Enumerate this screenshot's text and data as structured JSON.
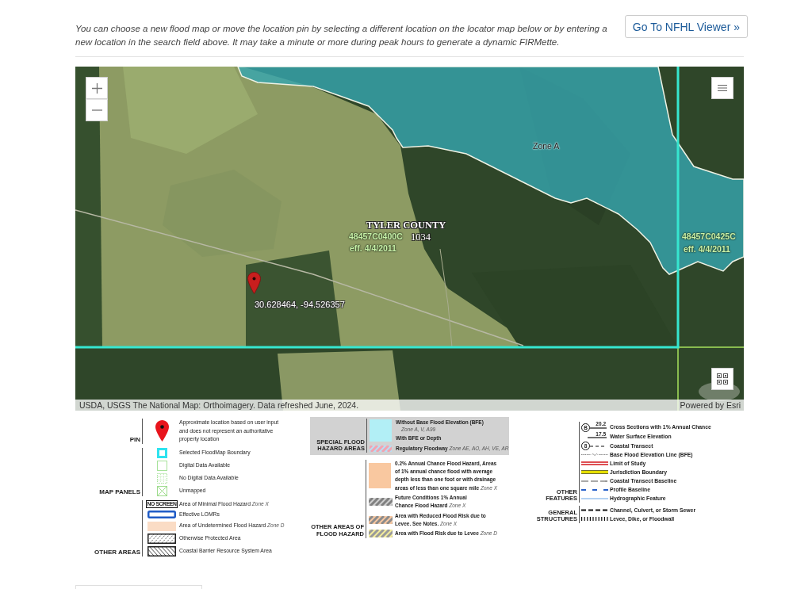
{
  "intro": {
    "text": "You can choose a new flood map or move the location pin by selecting a different location on the locator map below or by entering a new location in the search field above. It may take a minute or more during peak hours to generate a dynamic FIRMette.",
    "button": "Go To NFHL Viewer »"
  },
  "map": {
    "labels": [
      {
        "kind": "zone",
        "text": "Zone A"
      },
      {
        "kind": "county",
        "text": "TYLER COUNTY"
      },
      {
        "kind": "panel",
        "text": "48457C0400C"
      },
      {
        "kind": "community",
        "text": "1034"
      },
      {
        "kind": "date",
        "text": "eff. 4/4/2011"
      },
      {
        "kind": "panel",
        "text": "48457C0425C"
      },
      {
        "kind": "date",
        "text": "eff. 4/4/2011"
      }
    ],
    "pin": {
      "coordinates": "30.628464, -94.526357"
    },
    "attribution": "USDA, USGS The National Map: Orthoimagery. Data refreshed June, 2024.",
    "powered_by": "Powered by Esri"
  },
  "legend": {
    "columns": [
      {
        "groups": [
          {
            "title": "PIN",
            "shaded": false,
            "items": [
              {
                "kind": "pin",
                "text": "Approximate location based on user input and does not represent an authoritative property location"
              }
            ]
          },
          {
            "title": "MAP PANELS",
            "shaded": false,
            "items": [
              {
                "kind": "selected-boundary",
                "text": "Selected FloodMap Boundary"
              },
              {
                "kind": "digital",
                "text": "Digital Data Available"
              },
              {
                "kind": "no-digital",
                "text": "No Digital Data Available"
              },
              {
                "kind": "unmapped",
                "text": "Unmapped"
              }
            ]
          },
          {
            "title": "OTHER AREAS",
            "shaded": false,
            "items": [
              {
                "kind": "no-screen",
                "symbol_text": "NO SCREEN",
                "text": "Area of Minimal Flood Hazard",
                "zone": "Zone X"
              },
              {
                "kind": "lomr",
                "text": "Effective LOMRs"
              },
              {
                "kind": "undetermined",
                "text": "Area of Undetermined Flood Hazard",
                "zone": "Zone D"
              },
              {
                "kind": "protected",
                "text": "Otherwise Protected Area"
              },
              {
                "kind": "cbrs",
                "text": "Coastal Barrier Resource System Area"
              }
            ]
          }
        ]
      },
      {
        "groups": [
          {
            "title": "SPECIAL FLOOD HAZARD AREAS",
            "shaded": true,
            "items": [
              {
                "kind": "no-bfe",
                "text": "Without Base Flood Elevation (BFE)",
                "zone": "Zone A, V, A99"
              },
              {
                "kind": "with-bfe",
                "text": "With BFE or Depth"
              },
              {
                "kind": "floodway",
                "text": "Regulatory Floodway",
                "zone": "Zone AE, AO, AH, VE, AR"
              }
            ]
          },
          {
            "title": "OTHER AREAS OF FLOOD HAZARD",
            "shaded": false,
            "items": [
              {
                "kind": "x-shaded",
                "text": "0.2% Annual Chance Flood Hazard, Areas of 1% annual chance flood with average depth less than one foot or with drainage areas of less than one square mile",
                "zone": "Zone X"
              },
              {
                "kind": "future",
                "text": "Future Conditions 1% Annual Chance Flood Hazard",
                "zone": "Zone X"
              },
              {
                "kind": "reduced-levee",
                "text": "Area with Reduced Flood Risk due to Levee. See Notes.",
                "zone": "Zone X"
              },
              {
                "kind": "levee-risk",
                "text": "Area with Flood Risk due to Levee",
                "zone": "Zone D"
              }
            ]
          }
        ]
      },
      {
        "groups": [
          {
            "title": "OTHER FEATURES",
            "shaded": false,
            "items": [
              {
                "kind": "cross-section",
                "marker": "B",
                "value": "20.2",
                "text": "Cross Sections with 1% Annual Chance"
              },
              {
                "kind": "wse",
                "value": "17.5",
                "text": "Water Surface Elevation"
              },
              {
                "kind": "coastal-transect",
                "marker": "8",
                "text": "Coastal Transect"
              },
              {
                "kind": "bfe-line",
                "text": "Base Flood Elevation Line (BFE)"
              },
              {
                "kind": "limit-study",
                "text": "Limit of Study"
              },
              {
                "kind": "jurisdiction",
                "text": "Jurisdiction Boundary"
              },
              {
                "kind": "ct-baseline",
                "text": "Coastal Transect Baseline"
              },
              {
                "kind": "profile-baseline",
                "text": "Profile Baseline"
              },
              {
                "kind": "hydro",
                "text": "Hydrographic Feature"
              }
            ]
          },
          {
            "title": "GENERAL STRUCTURES",
            "shaded": false,
            "items": [
              {
                "kind": "channel",
                "text": "Channel, Culvert, or Storm Sewer"
              },
              {
                "kind": "levee",
                "text": "Levee, Dike, or Floodwall"
              }
            ]
          }
        ]
      }
    ]
  }
}
